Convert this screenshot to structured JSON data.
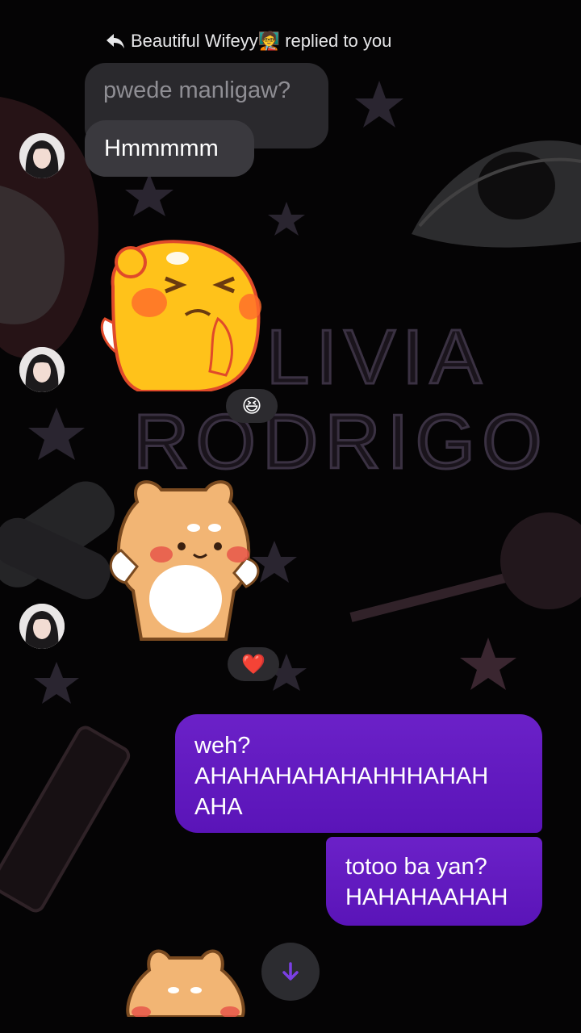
{
  "reply_header": {
    "icon": "reply-arrow-icon",
    "text": "Beautiful Wifeyy🧑‍🏫 replied to you"
  },
  "messages": {
    "quoted": "pwede manligaw?",
    "incoming_reply": "Hmmmmm",
    "reaction_1": "😆",
    "reaction_2": "❤️",
    "outgoing_1": [
      "weh?",
      "AHAHAHAHAHAHHHAHAH",
      "AHA"
    ],
    "outgoing_2": [
      "totoo ba yan?",
      "HAHAHAAHAH"
    ]
  },
  "background": {
    "wallpaper_text_line1": "LIVIA",
    "wallpaper_text_line2": "RODRIGO"
  },
  "colors": {
    "outgoing_bubble": "#6b21c8",
    "incoming_bubble": "#3a393e",
    "background": "#050405",
    "accent": "#7b3fe4"
  },
  "scroll_button": {
    "icon": "arrow-down-icon"
  }
}
